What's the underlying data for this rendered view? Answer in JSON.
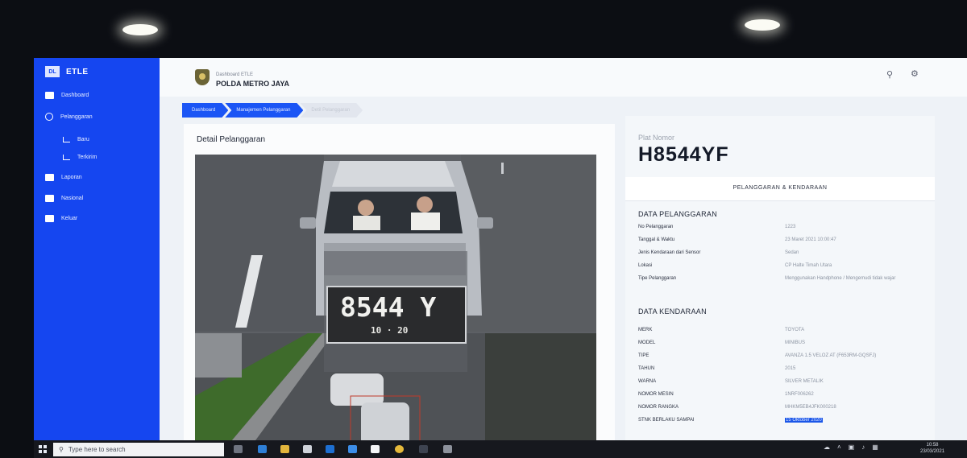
{
  "sidebar": {
    "logo": "DL",
    "app_name": "ETLE",
    "items": [
      {
        "label": "Dashboard",
        "icon": "grid-icon"
      },
      {
        "label": "Pelanggaran",
        "icon": "circle-icon"
      },
      {
        "label": "Baru",
        "icon": "tree-icon"
      },
      {
        "label": "Terkirim",
        "icon": "tree-icon"
      },
      {
        "label": "Laporan",
        "icon": "report-icon"
      },
      {
        "label": "Nasional",
        "icon": "flag-icon"
      },
      {
        "label": "Keluar",
        "icon": "logout-icon"
      }
    ]
  },
  "header": {
    "subtitle": "Dashboard ETLE",
    "title": "POLDA METRO JAYA"
  },
  "breadcrumb": [
    "Dashboard",
    "Manajemen Pelanggaran",
    "Detil Pelanggaran"
  ],
  "detail": {
    "title": "Detail Pelanggaran",
    "plate_crop": "8544 Y",
    "plate_crop_small": "10 · 20"
  },
  "info": {
    "plate_label": "Plat Nomor",
    "plate": "H8544YF",
    "tab": "PELANGGARAN & KENDARAAN",
    "pelanggaran_title": "DATA PELANGGARAN",
    "pelanggaran": [
      {
        "key": "No Pelanggaran",
        "value": "1223"
      },
      {
        "key": "Tanggal & Waktu",
        "value": "23 Maret 2021 10:00:47"
      },
      {
        "key": "Jenis Kendaraan dari Sensor",
        "value": "Sedan"
      },
      {
        "key": "Lokasi",
        "value": "CP Halte Timah Utara"
      },
      {
        "key": "Tipe Pelanggaran",
        "value": "Menggunakan Handphone / Mengemudi tidak wajar"
      }
    ],
    "kendaraan_title": "DATA KENDARAAN",
    "kendaraan": [
      {
        "key": "MERK",
        "value": "TOYOTA"
      },
      {
        "key": "MODEL",
        "value": "MINIBUS"
      },
      {
        "key": "TIPE",
        "value": "AVANZA 1.5 VELOZ AT (F653RM-GQSFJ)"
      },
      {
        "key": "TAHUN",
        "value": "2015"
      },
      {
        "key": "WARNA",
        "value": "SILVER METALIK"
      },
      {
        "key": "NOMOR MESIN",
        "value": "1NRF006262"
      },
      {
        "key": "NOMOR RANGKA",
        "value": "MHKM5EB4JFK000218"
      },
      {
        "key": "STNK BERLAKU SAMPAI",
        "value": "15 Oktober 2020"
      }
    ]
  },
  "taskbar": {
    "search_placeholder": "Type here to search",
    "time": "10:58",
    "date": "23/03/2021"
  },
  "colors": {
    "sidebar": "#1546f0",
    "breadcrumb_active": "#1b55f5",
    "selection": "#1a56e8"
  }
}
